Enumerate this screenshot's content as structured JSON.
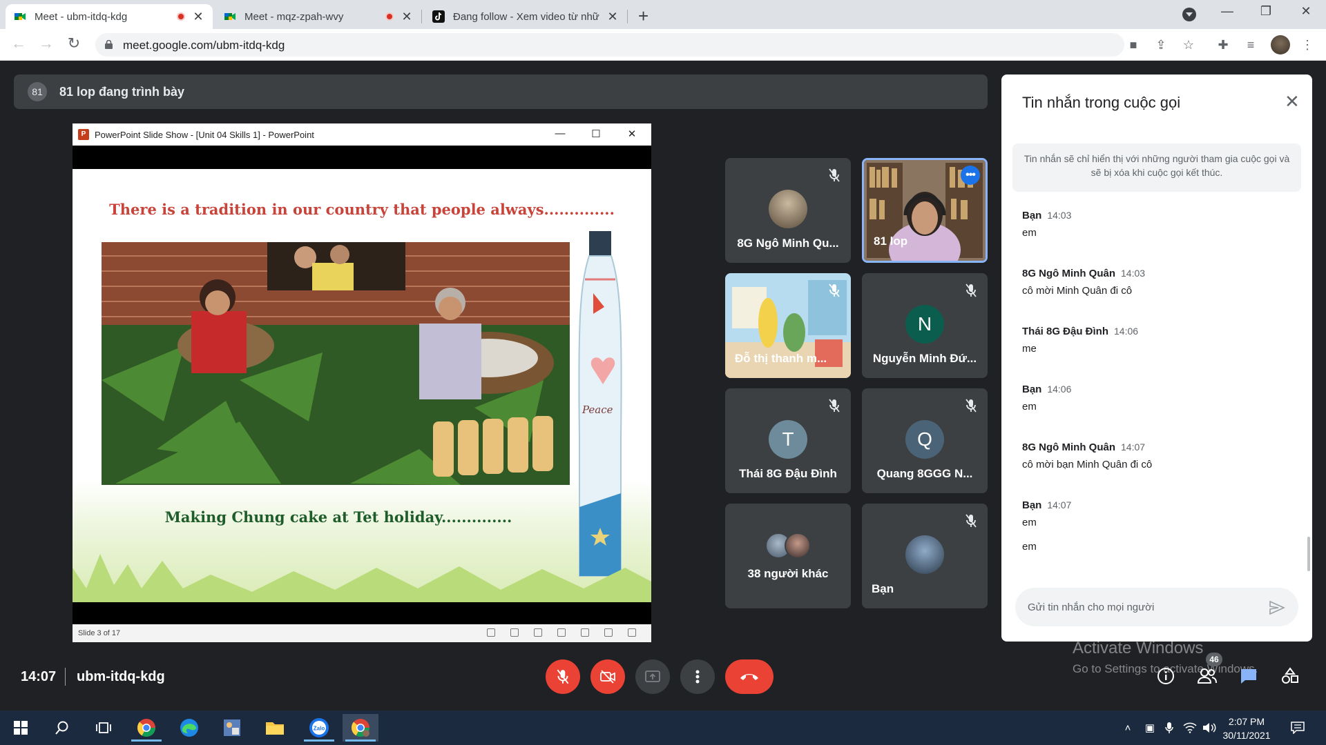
{
  "browser": {
    "tabs": [
      {
        "title": "Meet - ubm-itdq-kdg",
        "recording": true,
        "active": true
      },
      {
        "title": "Meet - mqz-zpah-wvy",
        "recording": true,
        "active": false
      },
      {
        "title": "Đang follow - Xem video từ những",
        "recording": false,
        "active": false
      }
    ],
    "new_tab_label": "+",
    "url": "meet.google.com/ubm-itdq-kdg"
  },
  "meet": {
    "presenting_badge": "81",
    "presenting_text": "81 lop đang trình bày",
    "meeting_time": "14:07",
    "meeting_code": "ubm-itdq-kdg",
    "people_count": "46"
  },
  "powerpoint": {
    "window_title": "PowerPoint Slide Show - [Unit 04  Skills 1] - PowerPoint",
    "slide_title": "There is a tradition in our country that people always..............",
    "slide_caption": "Making Chung cake at Tet holiday..............",
    "bottle_text": "Peace",
    "status": "Slide 3 of 17"
  },
  "participants": [
    {
      "name": "8G Ngô Minh Qu...",
      "type": "photo",
      "muted": true
    },
    {
      "name": "81 lop",
      "type": "video",
      "muted": false,
      "speaking": true
    },
    {
      "name": "Đỗ thị thanh m...",
      "type": "video-cartoon",
      "muted": true
    },
    {
      "name": "Nguyễn Minh Đứ...",
      "type": "initial",
      "initial": "N",
      "color": "#0b5e4e",
      "muted": true
    },
    {
      "name": "Thái 8G Đậu Đình",
      "type": "initial",
      "initial": "T",
      "color": "#6d8b9a",
      "muted": true
    },
    {
      "name": "Quang 8GGG N...",
      "type": "initial",
      "initial": "Q",
      "color": "#4b6377",
      "muted": true
    },
    {
      "name": "38 người khác",
      "type": "group",
      "muted": false
    },
    {
      "name": "Bạn",
      "type": "photo",
      "muted": true
    }
  ],
  "chat": {
    "title": "Tin nhắn trong cuộc gọi",
    "notice": "Tin nhắn sẽ chỉ hiển thị với những người tham gia cuộc gọi và sẽ bị xóa khi cuộc gọi kết thúc.",
    "messages": [
      {
        "sender": "Bạn",
        "time": "14:03",
        "text": "em"
      },
      {
        "sender": "8G Ngô Minh Quân",
        "time": "14:03",
        "text": "cô mời Minh Quân đi cô"
      },
      {
        "sender": "Thái 8G Đậu Đình",
        "time": "14:06",
        "text": "me"
      },
      {
        "sender": "Bạn",
        "time": "14:06",
        "text": "em"
      },
      {
        "sender": "8G Ngô Minh Quân",
        "time": "14:07",
        "text": "cô mời bạn Minh Quân đi cô"
      },
      {
        "sender": "Bạn",
        "time": "14:07",
        "text": "em",
        "extra": "em"
      }
    ],
    "input_placeholder": "Gửi tin nhắn cho mọi người"
  },
  "watermark": {
    "line1": "Activate Windows",
    "line2": "Go to Settings to activate Windows."
  },
  "taskbar": {
    "time": "2:07 PM",
    "date": "30/11/2021"
  },
  "colors": {
    "meet_bg": "#202124",
    "tile_bg": "#3c4043",
    "hangup_red": "#ea4335",
    "speaking_outline": "#8ab4f8",
    "accent_blue": "#1a73e8"
  }
}
